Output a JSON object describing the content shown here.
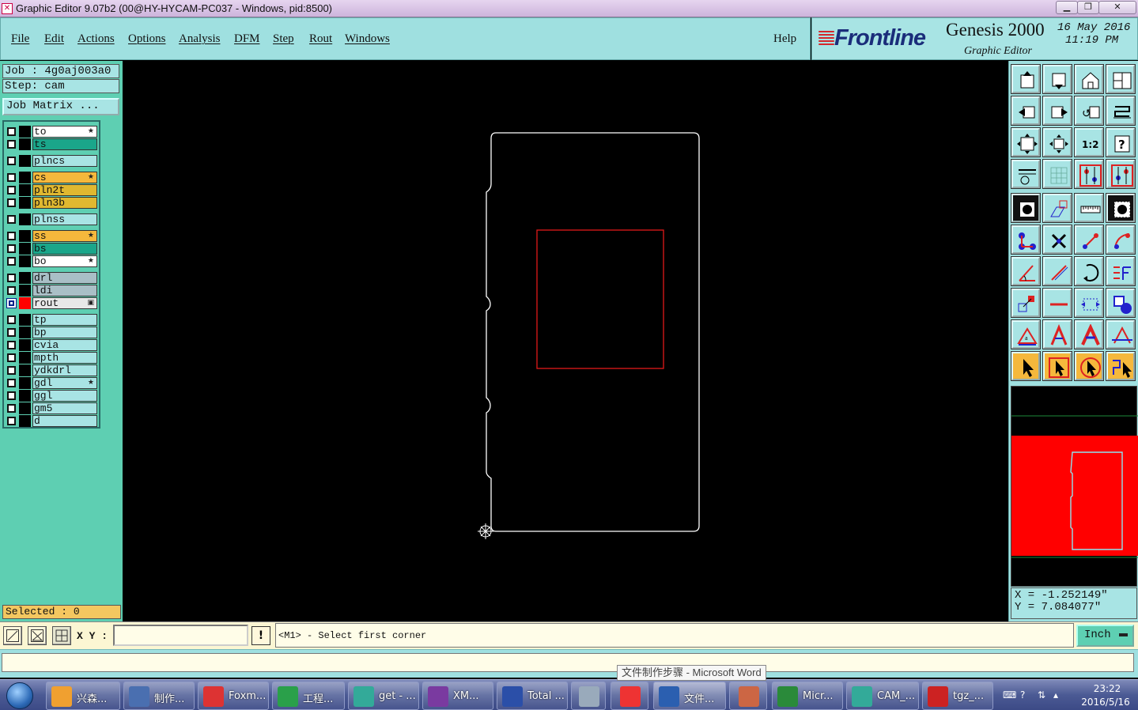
{
  "window": {
    "title": "Graphic Editor 9.07b2 (00@HY-HYCAM-PC037 - Windows, pid:8500)",
    "app_icon": "x-icon",
    "controls": [
      "minimize-icon",
      "maximize-icon",
      "close-icon"
    ]
  },
  "menu": {
    "items": [
      "File",
      "Edit",
      "Actions",
      "Options",
      "Analysis",
      "DFM",
      "Step",
      "Rout",
      "Windows"
    ],
    "help": "Help"
  },
  "brand": {
    "logo": "Frontline",
    "product": "Genesis 2000",
    "subtitle": "Graphic Editor",
    "date": "16 May 2016",
    "time": "11:19 PM"
  },
  "job": {
    "job_label": "Job : 4g0aj003a0",
    "step_label": "Step: cam",
    "matrix_button": "Job Matrix ..."
  },
  "layers": [
    {
      "name": "to",
      "color": "#ffffff",
      "mark": "★"
    },
    {
      "name": "ts",
      "color": "#1aa68a",
      "mark": ""
    },
    {
      "name": "plncs",
      "color": "#a8e4e4",
      "mark": ""
    },
    {
      "name": "cs",
      "color": "#f5b83c",
      "mark": "★"
    },
    {
      "name": "pln2t",
      "color": "#e0b830",
      "mark": ""
    },
    {
      "name": "pln3b",
      "color": "#e0b830",
      "mark": ""
    },
    {
      "name": "plnss",
      "color": "#a8e4e4",
      "mark": ""
    },
    {
      "name": "ss",
      "color": "#f5b83c",
      "mark": "★"
    },
    {
      "name": "bs",
      "color": "#1aa68a",
      "mark": ""
    },
    {
      "name": "bo",
      "color": "#ffffff",
      "mark": "★"
    },
    {
      "name": "drl",
      "color": "#a9bfc6",
      "mark": ""
    },
    {
      "name": "ldi",
      "color": "#a9bfc6",
      "mark": ""
    },
    {
      "name": "rout",
      "color": "#e8e8e8",
      "mark": "▣",
      "active": true
    },
    {
      "name": "tp",
      "color": "#a8e4e4",
      "mark": ""
    },
    {
      "name": "bp",
      "color": "#a8e4e4",
      "mark": ""
    },
    {
      "name": "cvia",
      "color": "#a8e4e4",
      "mark": ""
    },
    {
      "name": "mpth",
      "color": "#a8e4e4",
      "mark": ""
    },
    {
      "name": "ydkdrl",
      "color": "#a8e4e4",
      "mark": ""
    },
    {
      "name": "gdl",
      "color": "#a8e4e4",
      "mark": "★"
    },
    {
      "name": "ggl",
      "color": "#a8e4e4",
      "mark": ""
    },
    {
      "name": "gm5",
      "color": "#a8e4e4",
      "mark": ""
    },
    {
      "name": "d",
      "color": "#a8e4e4",
      "mark": ""
    }
  ],
  "selected": "Selected : 0",
  "tools": [
    "open-job-icon",
    "save-icon",
    "home-icon",
    "window-layout-icon",
    "previous-view-icon",
    "next-view-icon",
    "undo-view-icon",
    "redraw-icon",
    "zoom-fit-icon",
    "zoom-center-icon",
    "scale-one-to-two-icon",
    "help-icon",
    "settings-wrench-icon",
    "grid-icon",
    "snap-red-icon",
    "snap-blue-icon",
    "pad-icon",
    "transform-icon",
    "ruler-icon",
    "dot-icon",
    "connect-icon",
    "cross-icon",
    "line-points-icon",
    "arc-points-icon",
    "angle-icon",
    "slash-icon",
    "rotate-arc-icon",
    "flip-icon",
    "copy-shape-icon",
    "minus-icon",
    "measure-icon",
    "shapes-icon",
    "text-triangle-icon",
    "text-a-icon",
    "text-a-bold-icon",
    "text-a-line-icon",
    "select-arrow-icon",
    "select-box-icon",
    "select-circle-icon",
    "select-path-icon"
  ],
  "coords": {
    "x": "X = -1.252149\"",
    "y": "Y = 7.084077\""
  },
  "command": {
    "xy_label": "X Y :",
    "input_value": "",
    "prompt": "<M1> - Select first corner",
    "unit": "Inch"
  },
  "tooltip": "文件制作步骤 - Microsoft Word",
  "taskbar": {
    "items": [
      {
        "label": "兴森...",
        "icon": "star-app-icon",
        "color": "#f0a030"
      },
      {
        "label": "制作...",
        "icon": "notepad-icon",
        "color": "#4a6fb0"
      },
      {
        "label": "Foxm...",
        "icon": "foxmail-icon",
        "color": "#d33"
      },
      {
        "label": "工程...",
        "icon": "project-icon",
        "color": "#2aa04a"
      },
      {
        "label": "get - ...",
        "icon": "eye-app-icon",
        "color": "#3a9"
      },
      {
        "label": "XM...",
        "icon": "xmanager-icon",
        "color": "#7a3aa0"
      },
      {
        "label": "Total ...",
        "icon": "floppy-icon",
        "color": "#2b4fa8"
      },
      {
        "label": "",
        "icon": "calculator-icon",
        "color": "#9ab"
      },
      {
        "label": "",
        "icon": "browser-icon",
        "color": "#e33"
      },
      {
        "label": "文件...",
        "icon": "word-icon",
        "color": "#2b5fb0"
      },
      {
        "label": "",
        "icon": "powerpoint-icon",
        "color": "#c64"
      },
      {
        "label": "Micr...",
        "icon": "excel-icon",
        "color": "#2a8a3a"
      },
      {
        "label": "CAM_...",
        "icon": "cam-app-icon",
        "color": "#3a9"
      },
      {
        "label": "tgz_...",
        "icon": "pdf-icon",
        "color": "#c22"
      }
    ],
    "clock_time": "23:22",
    "clock_date": "2016/5/16"
  }
}
